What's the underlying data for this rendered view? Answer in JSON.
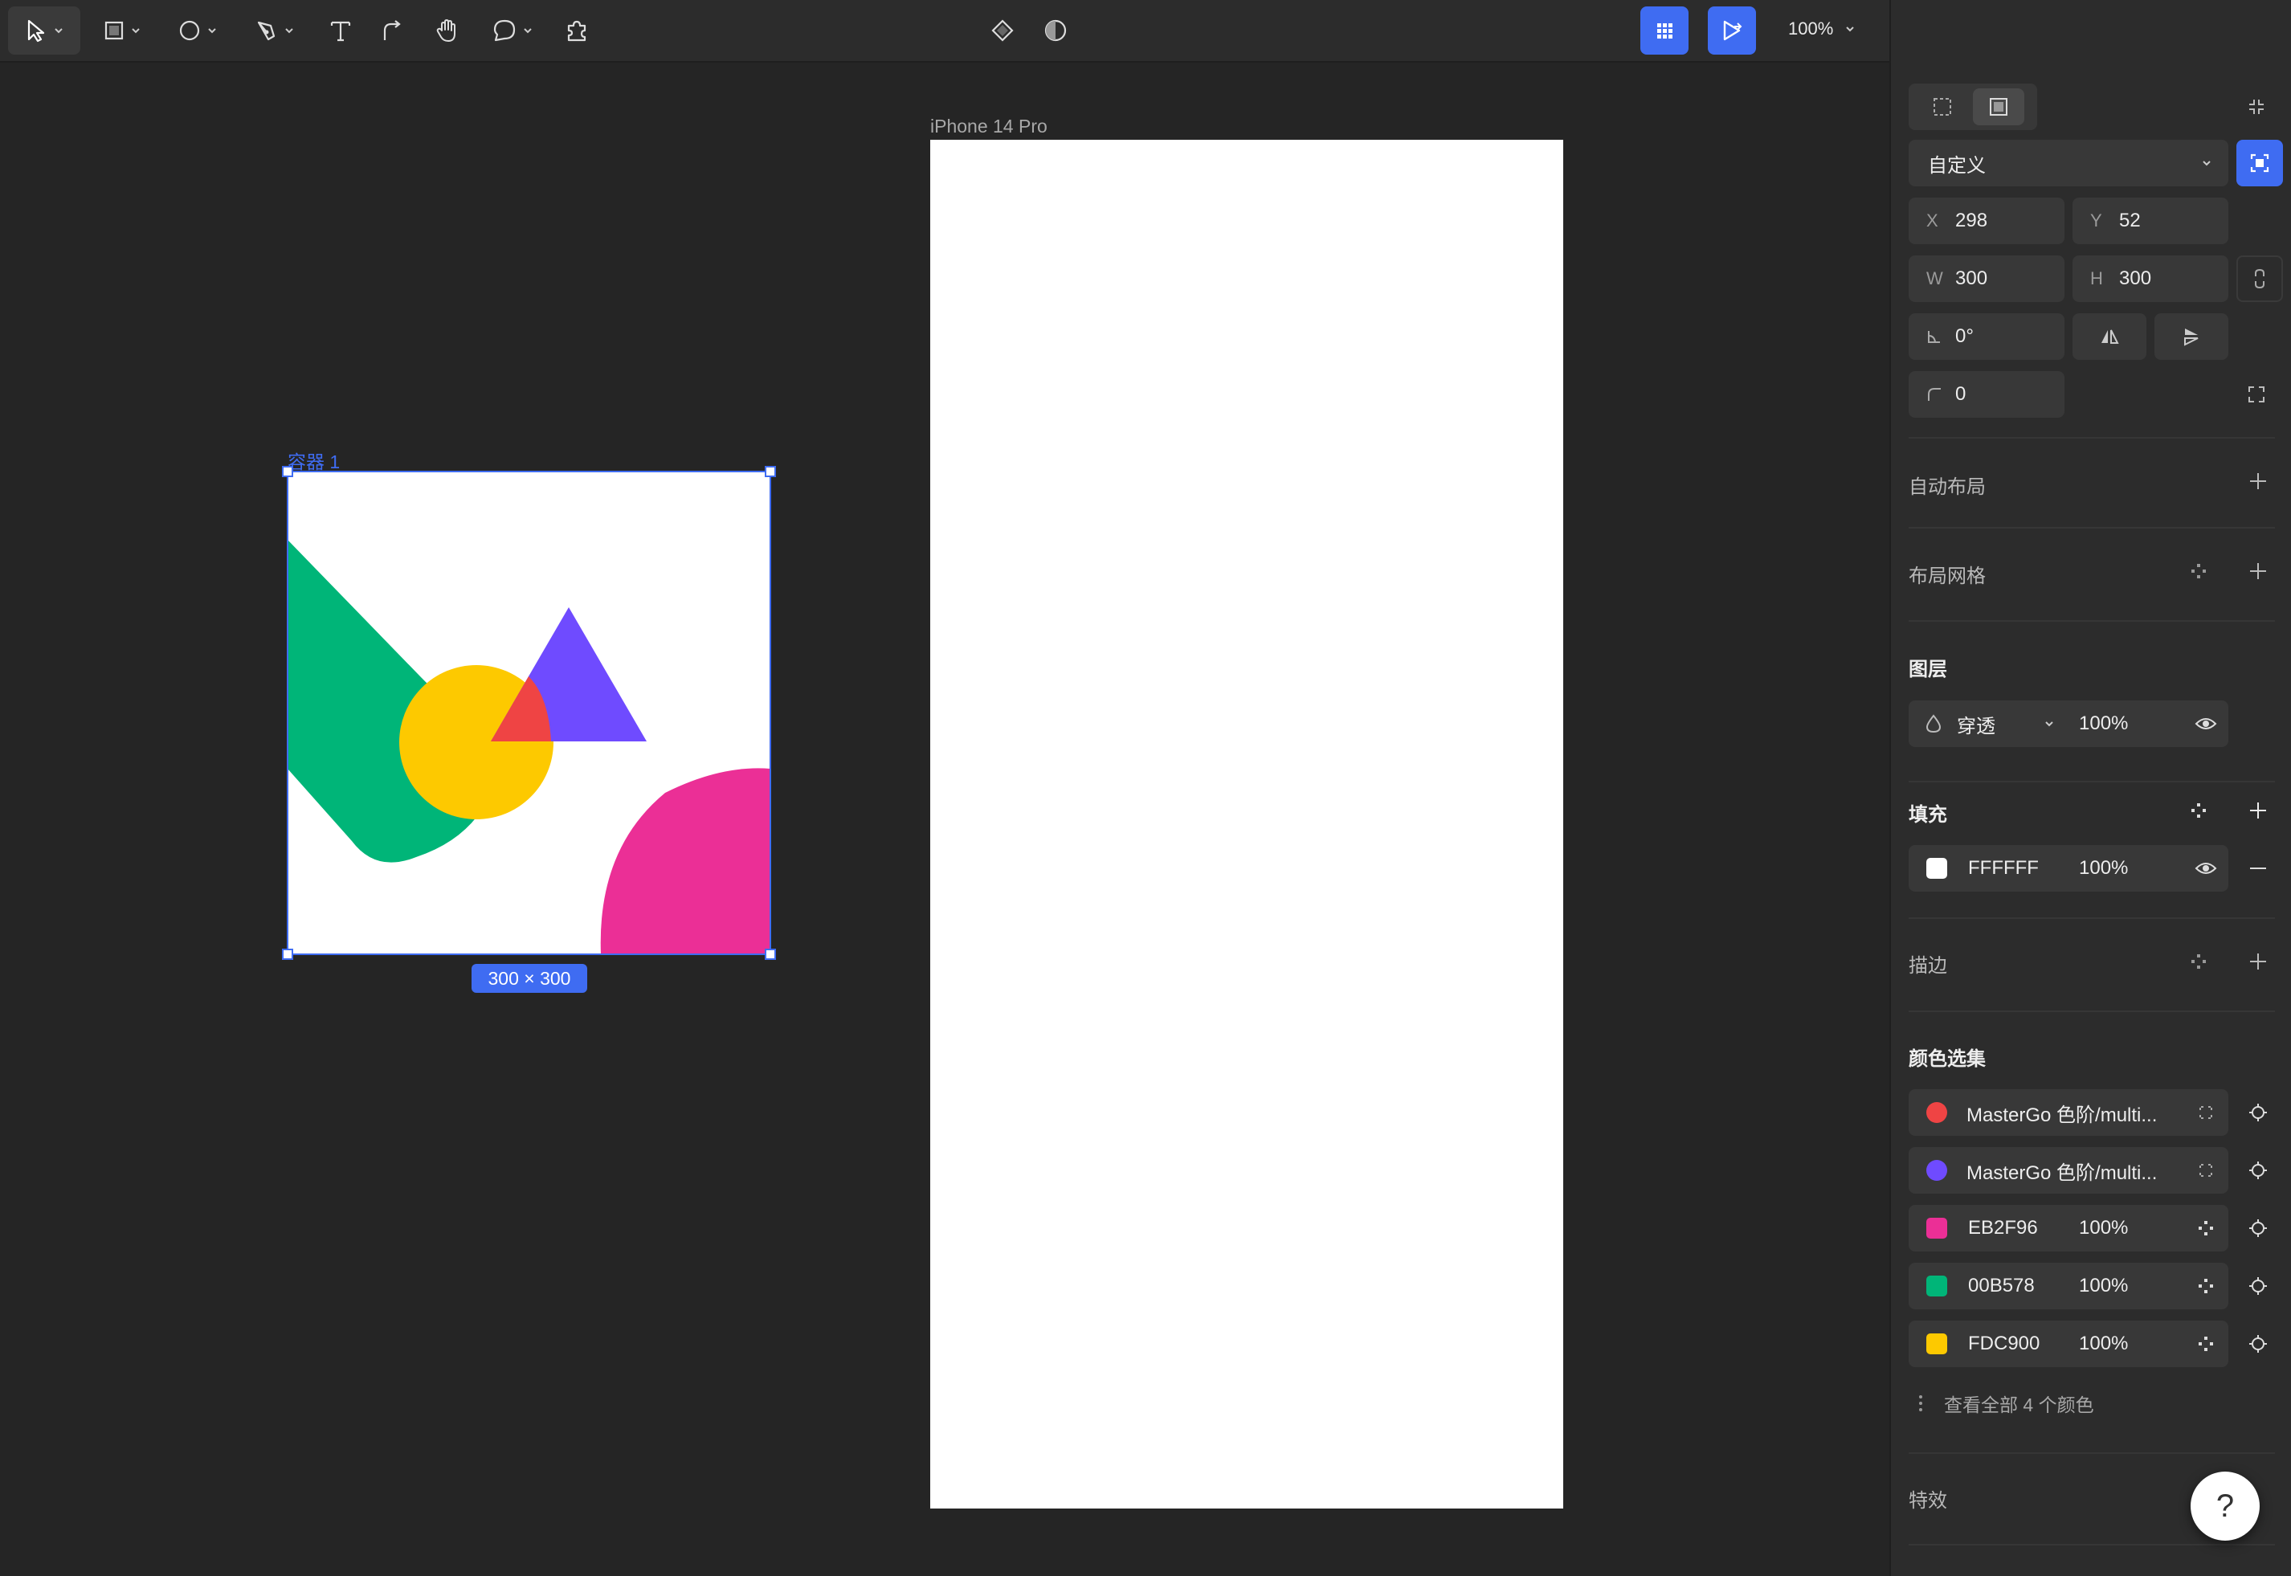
{
  "toolbar": {
    "zoom": "100%",
    "icons": [
      "move-icon",
      "rectangle-icon",
      "ellipse-icon",
      "pen-icon",
      "text-icon",
      "connector-icon",
      "hand-icon",
      "comment-icon",
      "plugin-icon",
      "component-icon",
      "mask-icon",
      "dev-mode-icon",
      "prototype-icon"
    ]
  },
  "canvas": {
    "frame_title": "iPhone 14 Pro",
    "selection_label": "容器 1",
    "selection_size": "300 × 300",
    "shape_colors": {
      "green": "#00B578",
      "yellow": "#FDC900",
      "purple": "#6F4BFF",
      "red": "#EF4444",
      "pink": "#EB2F96"
    }
  },
  "panel": {
    "preset": "自定义",
    "x_label": "X",
    "x_value": "298",
    "y_label": "Y",
    "y_value": "52",
    "w_label": "W",
    "w_value": "300",
    "h_label": "H",
    "h_value": "300",
    "rotation": "0°",
    "radius": "0",
    "auto_layout": "自动布局",
    "layout_grid": "布局网格",
    "layer": {
      "title": "图层",
      "blend_mode": "穿透",
      "opacity": "100%"
    },
    "fill": {
      "title": "填充",
      "hex": "FFFFFF",
      "opacity": "100%",
      "color": "#FFFFFF"
    },
    "stroke": "描边",
    "selection_colors": {
      "title": "颜色选集",
      "items": [
        {
          "label": "MasterGo 色阶/multi...",
          "color": "#EF4444",
          "style": true
        },
        {
          "label": "MasterGo 色阶/multi...",
          "color": "#6F4BFF",
          "style": true
        },
        {
          "label": "EB2F96",
          "opacity": "100%",
          "color": "#EB2F96"
        },
        {
          "label": "00B578",
          "opacity": "100%",
          "color": "#00B578"
        },
        {
          "label": "FDC900",
          "opacity": "100%",
          "color": "#FDC900"
        }
      ],
      "view_all": "查看全部 4 个颜色"
    },
    "effects": "特效"
  },
  "help_label": "?"
}
